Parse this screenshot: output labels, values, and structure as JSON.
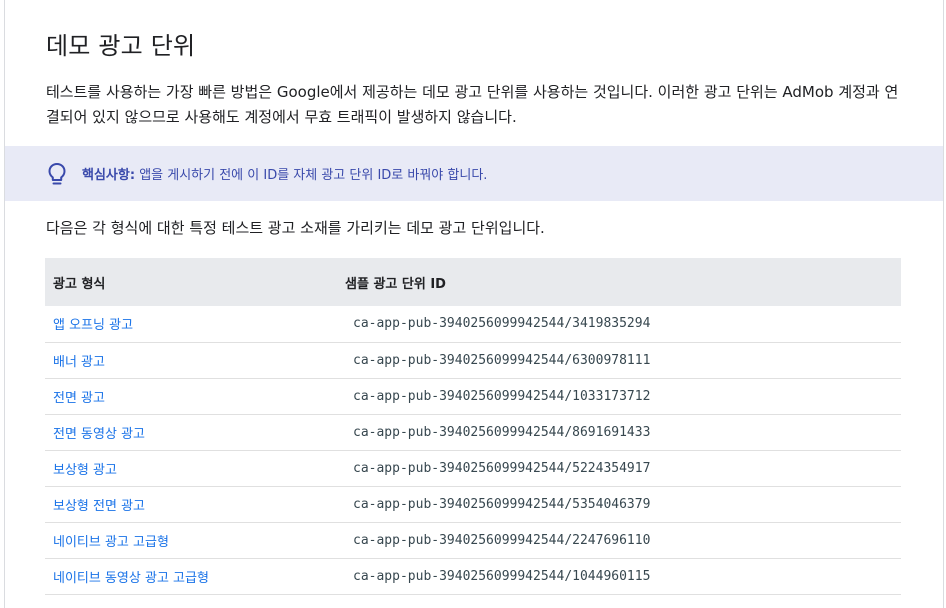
{
  "page": {
    "title": "데모 광고 단위",
    "intro": "테스트를 사용하는 가장 빠른 방법은 Google에서 제공하는 데모 광고 단위를 사용하는 것입니다. 이러한 광고 단위는 AdMob 계정과 연결되어 있지 않으므로 사용해도 계정에서 무효 트래픽이 발생하지 않습니다."
  },
  "callout": {
    "icon": "lightbulb-icon",
    "label": "핵심사항:",
    "text": "앱을 게시하기 전에 이 ID를 자체 광고 단위 ID로 바꿔야 합니다.",
    "accent": "#3949ab",
    "background": "#e8eaf6"
  },
  "table": {
    "intro": "다음은 각 형식에 대한 특정 테스트 광고 소재를 가리키는 데모 광고 단위입니다.",
    "headers": [
      "광고 형식",
      "샘플 광고 단위 ID"
    ],
    "rows": [
      {
        "format": "앱 오프닝 광고",
        "id": "ca-app-pub-3940256099942544/3419835294"
      },
      {
        "format": "배너 광고",
        "id": "ca-app-pub-3940256099942544/6300978111"
      },
      {
        "format": "전면 광고",
        "id": "ca-app-pub-3940256099942544/1033173712"
      },
      {
        "format": "전면 동영상 광고",
        "id": "ca-app-pub-3940256099942544/8691691433"
      },
      {
        "format": "보상형 광고",
        "id": "ca-app-pub-3940256099942544/5224354917"
      },
      {
        "format": "보상형 전면 광고",
        "id": "ca-app-pub-3940256099942544/5354046379"
      },
      {
        "format": "네이티브 광고 고급형",
        "id": "ca-app-pub-3940256099942544/2247696110"
      },
      {
        "format": "네이티브 동영상 광고 고급형",
        "id": "ca-app-pub-3940256099942544/1044960115"
      }
    ],
    "link_color": "#1a73e8",
    "header_background": "#e8eaed"
  }
}
